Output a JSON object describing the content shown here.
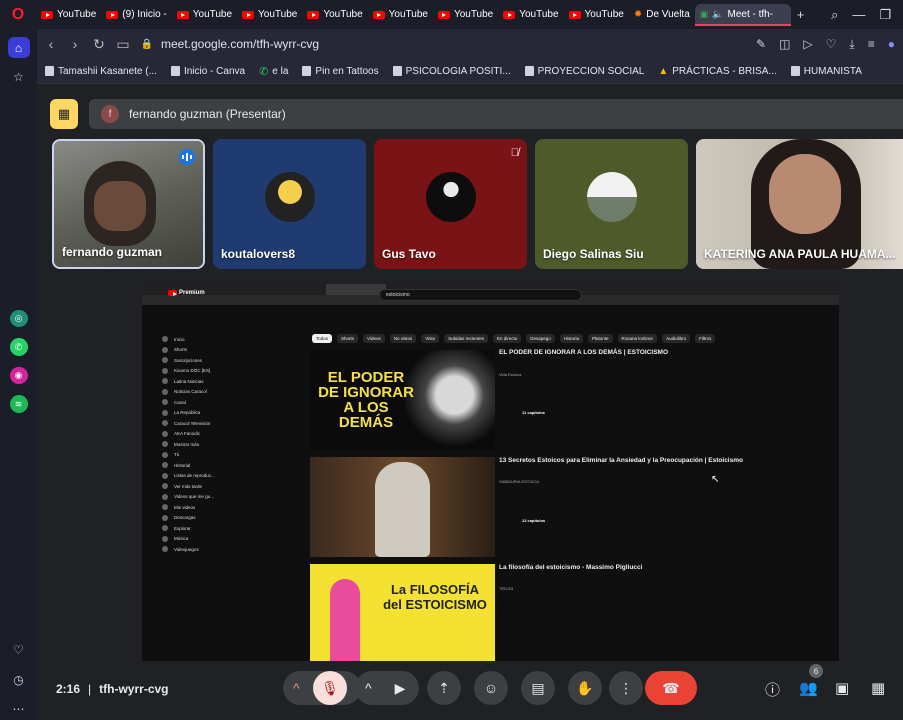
{
  "browser": {
    "tabs": [
      {
        "label": "YouTube",
        "icon": "youtube-icon"
      },
      {
        "label": "(9) Inicio -",
        "icon": "youtube-icon"
      },
      {
        "label": "YouTube",
        "icon": "youtube-icon"
      },
      {
        "label": "YouTube",
        "icon": "youtube-icon"
      },
      {
        "label": "YouTube",
        "icon": "youtube-icon"
      },
      {
        "label": "YouTube",
        "icon": "youtube-icon"
      },
      {
        "label": "YouTube",
        "icon": "youtube-icon"
      },
      {
        "label": "YouTube",
        "icon": "youtube-icon"
      },
      {
        "label": "YouTube",
        "icon": "youtube-icon"
      },
      {
        "label": "De Vuelta",
        "icon": "favicon-icon"
      },
      {
        "label": "Meet - tfh-",
        "icon": "meet-icon"
      }
    ],
    "url": "meet.google.com/tfh-wyrr-cvg",
    "bookmarks": [
      "Tamashii Kasanete (...",
      "Inicio - Canva",
      "e la",
      "Pin en Tattoos",
      "PSICOLOGIA POSITI...",
      "PROYECCION SOCIAL",
      "PRÁCTICAS - BRISA...",
      "HUMANISTA"
    ]
  },
  "meet": {
    "presenter": "fernando guzman (Presentar)",
    "presenter_initial": "f",
    "participants": [
      {
        "name": "fernando guzman"
      },
      {
        "name": "koutalovers8"
      },
      {
        "name": "Gus Tavo"
      },
      {
        "name": "Diego Salinas Siu"
      },
      {
        "name": "KATERING ANA PAULA HUAMA..."
      }
    ],
    "time": "2:16",
    "sep": "|",
    "code": "tfh-wyrr-cvg",
    "people_count": "6"
  },
  "shared_screen": {
    "search": "estoicismo",
    "logo": "Premium",
    "chips": [
      "Todos",
      "Shorts",
      "Videos",
      "No vistos",
      "Visto",
      "Subidas recientes",
      "En directo",
      "Desapego",
      "Historia",
      "Platonte",
      "Rosana lonknor",
      "Audiolibro",
      "Filtros"
    ],
    "sidebar": [
      "Inicio",
      "Shorts",
      "Suscripciones",
      "Kioomo DOC [ES]",
      "Latina Noticias",
      "Noticias Caracol",
      "Canal",
      "La República",
      "Caracol Televisión",
      "AKA Fanodic",
      "Mostrar más",
      "Tú",
      "Historial",
      "Listas de reproduc...",
      "Ver más tarde",
      "Videos que me gu...",
      "Mis videos",
      "Descargas",
      "Explorar",
      "Música",
      "Videojuegos"
    ],
    "videos": [
      {
        "title": "EL PODER DE IGNORAR A LOS DEMÁS | ESTOICISMO",
        "thumb_text": "EL PODER DE IGNORAR A LOS DEMÁS",
        "meta": "Vida Estoica",
        "chapters": "11 capítulos"
      },
      {
        "title": "13 Secretos Estoicos para Eliminar la Ansiedad y la Preocupación | Estoicismo",
        "thumb_text": "",
        "meta": "SABIDURIA ESTOICA",
        "chapters": "13 capítulos"
      },
      {
        "title": "La filosofía del estoicismo - Massimo Pigliucci",
        "thumb_text": "La FILOSOFÍA del ESTOICISMO",
        "meta": "TED-Ed",
        "chapters": ""
      }
    ]
  },
  "colors": {
    "accent": "#1a73e8",
    "end_call": "#ea4335",
    "presenter_badge": "#fdd663"
  }
}
